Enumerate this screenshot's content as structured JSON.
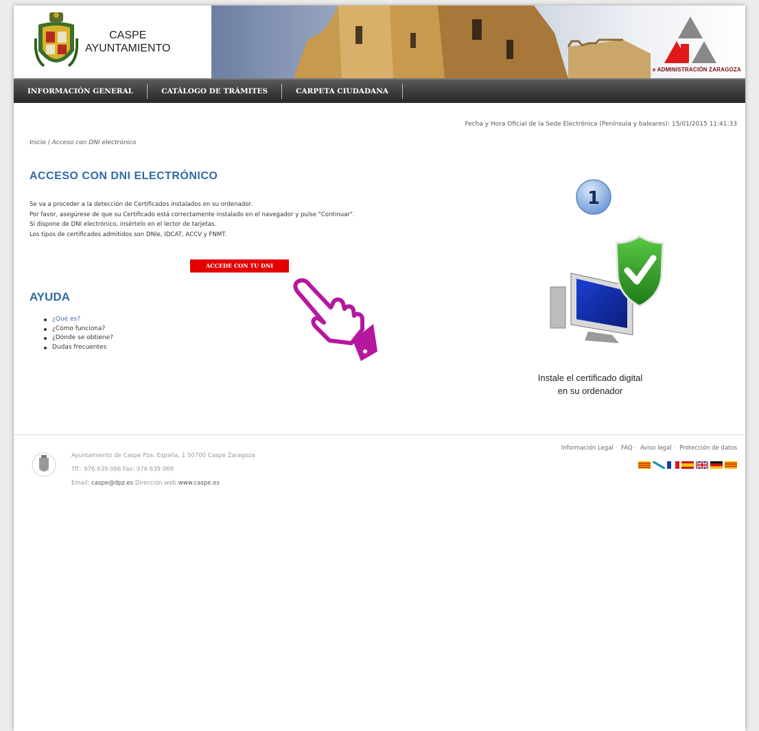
{
  "header": {
    "brand_line1": "CASPE",
    "brand_line2": "AYUNTAMIENTO",
    "eadmin_label": "e ADMINISTRACIÓN ZARAGOZA"
  },
  "nav": [
    {
      "label": "INFORMACIÓN GENERAL"
    },
    {
      "label": "CATÁLOGO DE TRÁMITES"
    },
    {
      "label": "CARPETA CIUDADANA"
    }
  ],
  "datetime": "Fecha y Hora Oficial de la Sede Electrónica (Península y baleares):  15/01/2015 11:41:33",
  "breadcrumb": {
    "home": "Inicio",
    "separator": "/",
    "current": "Acceso con DNI electrónico"
  },
  "main": {
    "title": "ACCESO CON DNI ELECTRÓNICO",
    "intro": [
      "Se va a proceder a la detección de Certificados instalados en su ordenador.",
      "Por favor, asegúrese de que su Certificado está correctamente instalado en el navegador y pulse \"Continuar\".",
      "Si dispone de DNI electrónico, insértelo en el lector de tarjetas.",
      "Los tipos de certificados admitidos son DNIe, IDCAT, ACCV y FNMT."
    ],
    "dni_button": "ACCEDE CON TU DNI",
    "help_title": "AYUDA",
    "help_items": [
      {
        "label": "¿Qué es?"
      },
      {
        "label": "¿Cómo funciona?"
      },
      {
        "label": "¿Dónde se obtiene?"
      },
      {
        "label": "Dudas frecuentes"
      }
    ],
    "step_number": "1",
    "caption_line1": "Instale el certificado digital",
    "caption_line2": "en su ordenador"
  },
  "footer": {
    "address": "Ayuntamiento de Caspe Pza. España, 1 50700 Caspe Zaragoza",
    "phone": "Tlf.: 976 639 066 Fax: 976 639 069",
    "email_label": "Email:",
    "email": "caspe@dpz.es",
    "web_label": "Dirección web:",
    "web": "www.caspe.es",
    "links": [
      "Información Legal",
      "FAQ",
      "Aviso legal",
      "Protección de datos"
    ],
    "flags": [
      "catalan-flag",
      "galician-flag",
      "french-flag",
      "spanish-flag",
      "uk-flag",
      "german-flag",
      "aragonese-flag"
    ]
  },
  "colors": {
    "accent_blue": "#2f6aa8",
    "button_red": "#e30000",
    "nav_dark": "#3c3c3c",
    "hand_magenta": "#b5179e"
  }
}
